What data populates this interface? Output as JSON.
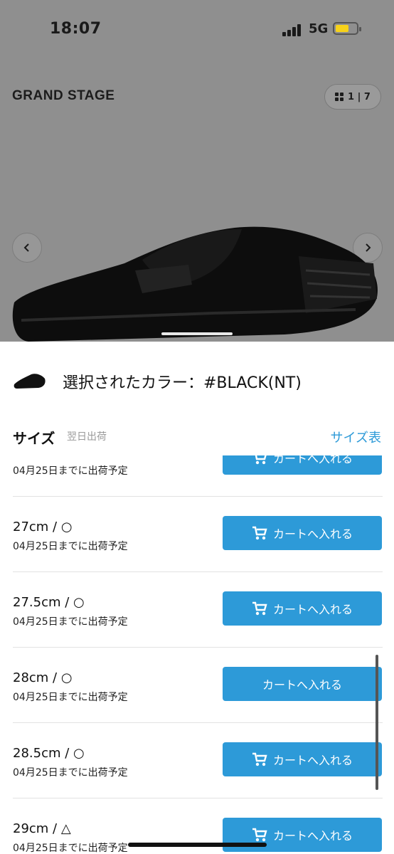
{
  "status": {
    "time": "18:07",
    "network": "5G"
  },
  "header": {
    "brand": "GRAND STAGE",
    "counter": "1 | 7"
  },
  "selection": {
    "label": "選択されたカラー：#BLACK(NT)"
  },
  "size_section": {
    "title": "サイズ",
    "subtitle": "翌日出荷",
    "size_table_link": "サイズ表"
  },
  "rows": [
    {
      "size": "",
      "ship": "04月25日までに出荷予定",
      "button": "カートへ入れる"
    },
    {
      "size": "27cm / ○",
      "ship": "04月25日までに出荷予定",
      "button": "カートへ入れる"
    },
    {
      "size": "27.5cm / ○",
      "ship": "04月25日までに出荷予定",
      "button": "カートへ入れる"
    },
    {
      "size": "28cm / ○",
      "ship": "04月25日までに出荷予定",
      "button": "カートへ入れる"
    },
    {
      "size": "28.5cm / ○",
      "ship": "04月25日までに出荷予定",
      "button": "カートへ入れる"
    },
    {
      "size": "29cm / △",
      "ship": "04月25日までに出荷予定",
      "button": "カートへ入れる"
    }
  ],
  "colors": {
    "accent": "#2d9ad8",
    "overlay": "#8f8f8f"
  }
}
